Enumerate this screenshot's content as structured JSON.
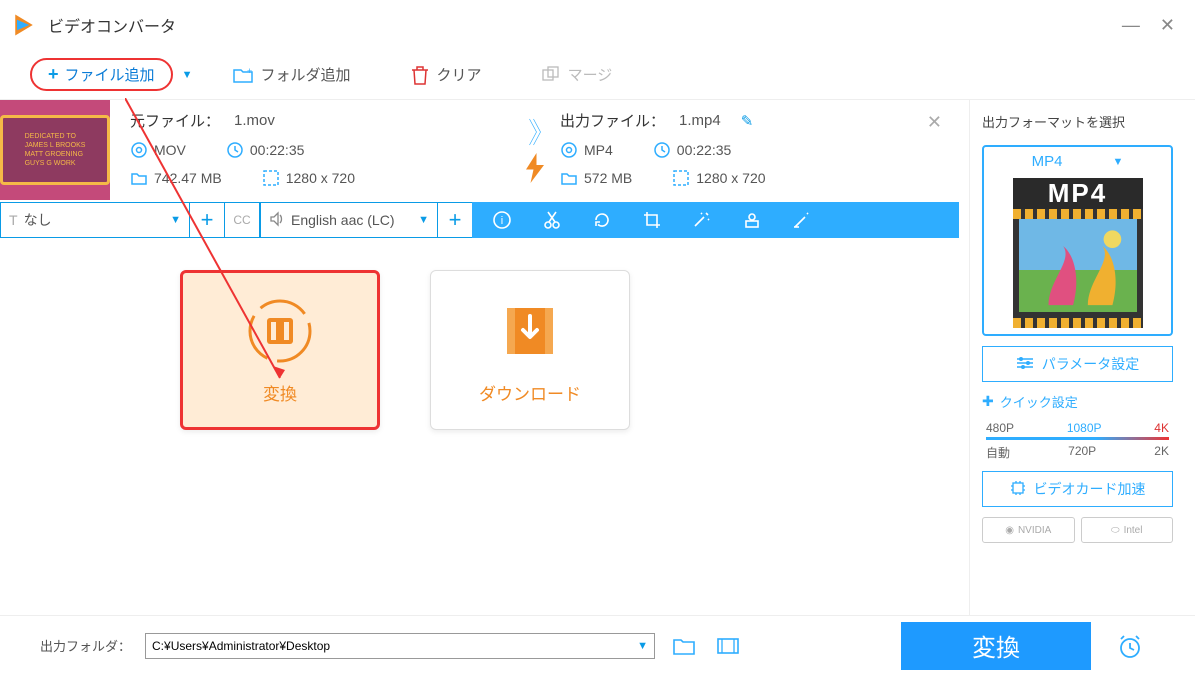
{
  "window": {
    "title": "ビデオコンバータ"
  },
  "toolbar": {
    "add_file": "ファイル追加",
    "add_folder": "フォルダ追加",
    "clear": "クリア",
    "merge": "マージ"
  },
  "file": {
    "source_label": "元ファイル：",
    "source_name": "1.mov",
    "source_format": "MOV",
    "source_duration": "00:22:35",
    "source_size": "742.47 MB",
    "source_res": "1280 x 720",
    "output_label": "出力ファイル：",
    "output_name": "1.mp4",
    "output_format": "MP4",
    "output_duration": "00:22:35",
    "output_size": "572 MB",
    "output_res": "1280 x 720"
  },
  "subbar": {
    "subtitle": "なし",
    "audio": "English aac (LC)"
  },
  "actions": {
    "convert": "変換",
    "download": "ダウンロード"
  },
  "right": {
    "title": "出力フォーマットを選択",
    "format": "MP4",
    "preview_label": "MP4",
    "param_settings": "パラメータ設定",
    "quick_settings": "クイック設定",
    "q": {
      "auto": "自動",
      "p480": "480P",
      "p720": "720P",
      "p1080": "1080P",
      "k2": "2K",
      "k4": "4K"
    },
    "gpu_accel": "ビデオカード加速",
    "nvidia": "NVIDIA",
    "intel": "Intel"
  },
  "bottom": {
    "label": "出力フォルダ：",
    "path": "C:¥Users¥Administrator¥Desktop",
    "convert": "変換"
  }
}
